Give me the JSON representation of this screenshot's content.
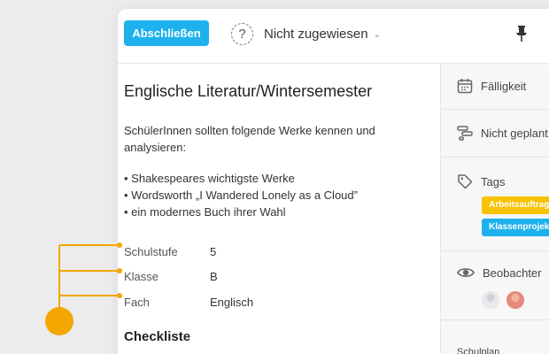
{
  "colors": {
    "accent": "#1eb1ee",
    "annotation": "#f5a600",
    "tag_yellow": "#f7c200",
    "tag_blue": "#1eb1ee"
  },
  "toolbar": {
    "complete_label": "Abschließen",
    "assignee_icon": "question-mark-dashed-icon",
    "assignee_label": "Nicht zugewiesen",
    "assignee_chevron": "chevron-down-icon",
    "pin_icon": "pin-icon"
  },
  "task": {
    "title": "Englische Literatur/Wintersemester",
    "description": "SchülerInnen sollten folgende Werke kennen und analysieren:",
    "bullets": [
      "Shakespeares wichtigste Werke",
      "Wordsworth „I Wandered Lonely as a Cloud”",
      "ein modernes Buch ihrer Wahl"
    ],
    "properties": [
      {
        "key": "Schulstufe",
        "value": "5"
      },
      {
        "key": "Klasse",
        "value": "B"
      },
      {
        "key": "Fach",
        "value": "Englisch"
      }
    ],
    "checklist_title": "Checkliste"
  },
  "sidebar": {
    "due_label": "Fälligkeit",
    "due_icon": "calendar-icon",
    "schedule_label": "Nicht geplant",
    "schedule_icon": "gantt-icon",
    "tags_label": "Tags",
    "tags_icon": "tag-icon",
    "tags": [
      {
        "label": "Arbeitsauftrag",
        "color": "#f7c200"
      },
      {
        "label": "Klassenprojekt",
        "color": "#1eb1ee"
      }
    ],
    "followers_label": "Beobachter",
    "followers_icon": "eye-icon",
    "plan_label": "Schulplan"
  }
}
